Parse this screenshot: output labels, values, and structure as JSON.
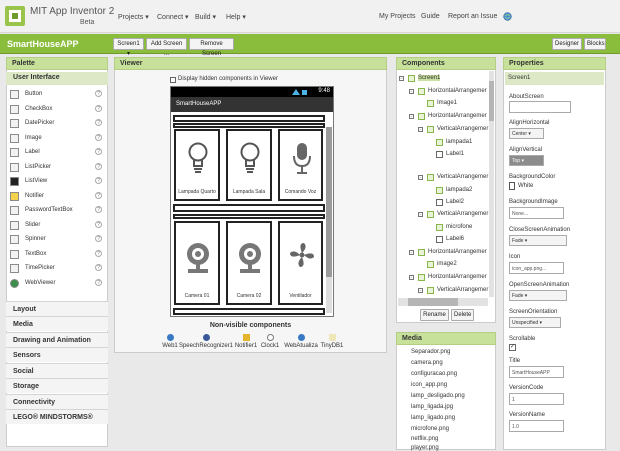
{
  "header": {
    "app_title": "MIT App Inventor 2",
    "beta": "Beta",
    "menus": [
      "Projects ▾",
      "Connect ▾",
      "Build ▾",
      "Help ▾"
    ],
    "right_menus": [
      "My Projects",
      "Guide",
      "Report an Issue"
    ],
    "logo_icon": "app-inventor-logo-icon",
    "globe_icon": "globe-icon"
  },
  "appbar": {
    "project_name": "SmartHouseAPP",
    "screen_select": "Screen1 ▾",
    "add_screen": "Add Screen ...",
    "remove_screen": "Remove Screen",
    "designer": "Designer",
    "blocks": "Blocks"
  },
  "palette": {
    "title": "Palette",
    "section": "User Interface",
    "items": [
      {
        "label": "Button"
      },
      {
        "label": "CheckBox"
      },
      {
        "label": "DatePicker"
      },
      {
        "label": "Image"
      },
      {
        "label": "Label"
      },
      {
        "label": "ListPicker"
      },
      {
        "label": "ListView"
      },
      {
        "label": "Notifier"
      },
      {
        "label": "PasswordTextBox"
      },
      {
        "label": "Slider"
      },
      {
        "label": "Spinner"
      },
      {
        "label": "TextBox"
      },
      {
        "label": "TimePicker"
      },
      {
        "label": "WebViewer"
      }
    ],
    "help": "?",
    "categories": [
      "Layout",
      "Media",
      "Drawing and Animation",
      "Sensors",
      "Social",
      "Storage",
      "Connectivity",
      "LEGO® MINDSTORMS®"
    ]
  },
  "viewer": {
    "title": "Viewer",
    "hidden_checkbox": "Display hidden components in Viewer",
    "phone_title": "SmartHouseAPP",
    "status_time": "9:48",
    "cards": [
      {
        "label": "Lampada Quarto",
        "icon": "light-bulb-icon"
      },
      {
        "label": "Lampada Sala",
        "icon": "light-bulb-icon"
      },
      {
        "label": "Comando Voz",
        "icon": "microphone-icon"
      },
      {
        "label": "Camera 01",
        "icon": "webcam-icon"
      },
      {
        "label": "Camera 02",
        "icon": "webcam-icon"
      },
      {
        "label": "Ventilador",
        "icon": "fan-icon"
      }
    ],
    "nonvisible_title": "Non-visible components",
    "nonvisible": [
      "Web1",
      "SpeechRecognizer1",
      "Notifier1",
      "Clock1",
      "WebAtualiza",
      "TinyDB1"
    ]
  },
  "components": {
    "title": "Components",
    "tree": [
      {
        "label": "Screen1"
      },
      {
        "label": "HorizontalArrangemer"
      },
      {
        "label": "Image1"
      },
      {
        "label": "HorizontalArrangemer"
      },
      {
        "label": "VerticalArrangemer"
      },
      {
        "label": "lampada1"
      },
      {
        "label": "Label1"
      },
      {
        "label": "VerticalArrangemer"
      },
      {
        "label": "lampada2"
      },
      {
        "label": "Label2"
      },
      {
        "label": "VerticalArrangemer"
      },
      {
        "label": "microfone"
      },
      {
        "label": "Label6"
      },
      {
        "label": "HorizontalArrangemer"
      },
      {
        "label": "image2"
      },
      {
        "label": "HorizontalArrangemer"
      },
      {
        "label": "VerticalArrangemer"
      }
    ],
    "toggle_minus": "−",
    "rename": "Rename",
    "delete": "Delete"
  },
  "media": {
    "title": "Media",
    "files": [
      "Separador.png",
      "camera.png",
      "configuracao.png",
      "icon_app.png",
      "lamp_desligado.png",
      "lamp_ligada.jpg",
      "lamp_ligado.png",
      "microfone.png",
      "netflix.png",
      "player.png"
    ]
  },
  "properties": {
    "title": "Properties",
    "component": "Screen1",
    "about_label": "AboutScreen",
    "align_h_label": "AlignHorizontal",
    "align_h_value": "Center ▾",
    "align_v_label": "AlignVertical",
    "align_v_value": "Top ▾",
    "bg_color_label": "BackgroundColor",
    "bg_color_value": "White",
    "bg_image_label": "BackgroundImage",
    "bg_image_value": "None...",
    "close_anim_label": "CloseScreenAnimation",
    "close_anim_value": "Fade ▾",
    "icon_label": "Icon",
    "icon_value": "icon_app.png...",
    "open_anim_label": "OpenScreenAnimation",
    "open_anim_value": "Fade ▾",
    "orientation_label": "ScreenOrientation",
    "orientation_value": "Unspecified ▾",
    "scrollable_label": "Scrollable",
    "check": "✓",
    "title_label": "Title",
    "title_value": "SmartHouseAPP",
    "version_code_label": "VersionCode",
    "version_code_value": "1",
    "version_name_label": "VersionName",
    "version_name_value": "1.0"
  },
  "colors": {
    "accent": "#8bbd3c",
    "panel_header": "#c7e09a"
  }
}
